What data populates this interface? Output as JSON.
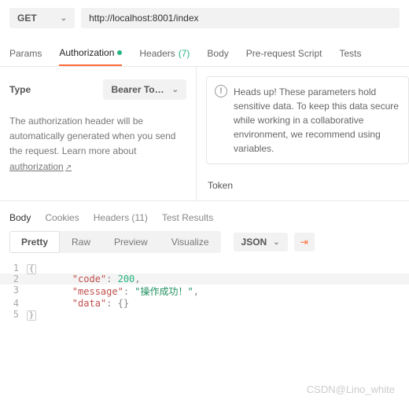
{
  "request": {
    "method": "GET",
    "url": "http://localhost:8001/index"
  },
  "tabs": {
    "params": "Params",
    "authorization": "Authorization",
    "headers": "Headers",
    "headers_count": "(7)",
    "body": "Body",
    "pre_request": "Pre-request Script",
    "tests": "Tests"
  },
  "auth": {
    "type_label": "Type",
    "type_value": "Bearer To…",
    "description": "The authorization header will be automatically generated when you send the request. Learn more about ",
    "learn_link": "authorization",
    "alert": "Heads up! These parameters hold sensitive data. To keep this data secure while working in a collaborative environment, we recommend using variables.",
    "token_label": "Token"
  },
  "response_tabs": {
    "body": "Body",
    "cookies": "Cookies",
    "headers": "Headers",
    "headers_count": "(11)",
    "test_results": "Test Results"
  },
  "view": {
    "pretty": "Pretty",
    "raw": "Raw",
    "preview": "Preview",
    "visualize": "Visualize",
    "format": "JSON"
  },
  "code_lines": {
    "l2_key": "\"code\"",
    "l2_val": "200",
    "l3_key": "\"message\"",
    "l3_val": "\"操作成功！\"",
    "l4_key": "\"data\"",
    "l4_val": "{}"
  },
  "watermark": "CSDN@Lino_white"
}
